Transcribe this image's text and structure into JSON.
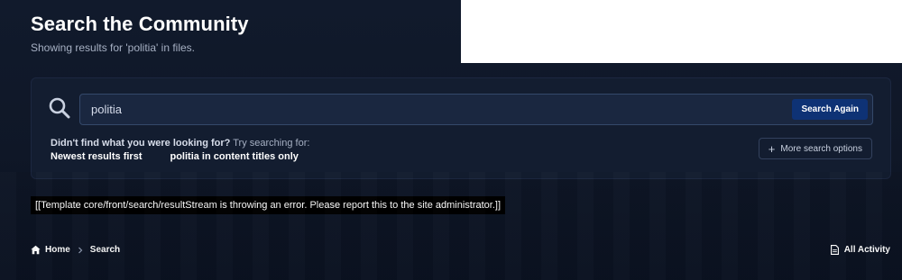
{
  "header": {
    "title": "Search the Community",
    "subtitle": "Showing results for 'politia' in files."
  },
  "search": {
    "value": "politia",
    "search_again_label": "Search Again",
    "hint_strong": "Didn't find what you were looking for?",
    "hint_rest": " Try searching for:",
    "suggestions": [
      "Newest results first",
      "politia in content titles only"
    ],
    "more_options_label": "More search options"
  },
  "error_message": "[[Template core/front/search/resultStream is throwing an error. Please report this to the site administrator.]]",
  "breadcrumb": {
    "home": "Home",
    "current": "Search"
  },
  "footer": {
    "all_activity": "All Activity"
  },
  "icons": {
    "search": "search-icon",
    "plus": "plus-icon",
    "home": "home-icon",
    "chevron": "chevron-right-icon",
    "activity": "document-icon"
  },
  "colors": {
    "background": "#0f1727",
    "panel": "#131d30",
    "field": "#1a2740",
    "accent_button": "#0e3275"
  }
}
